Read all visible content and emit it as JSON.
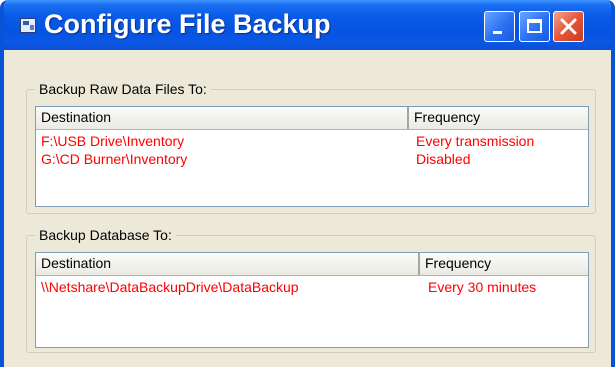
{
  "window": {
    "title": "Configure File Backup",
    "icon": "app-window-icon",
    "controls": [
      "minimize-icon",
      "maximize-icon",
      "close-icon"
    ]
  },
  "raw_files_group": {
    "label": "Backup Raw Data Files To:",
    "columns": [
      "Destination",
      "Frequency"
    ],
    "rows": [
      {
        "destination": "F:\\USB Drive\\Inventory",
        "frequency": "Every transmission"
      },
      {
        "destination": "G:\\CD Burner\\Inventory",
        "frequency": "Disabled"
      }
    ]
  },
  "database_group": {
    "label": "Backup Database To:",
    "columns": [
      "Destination",
      "Frequency"
    ],
    "rows": [
      {
        "destination": "\\\\Netshare\\DataBackupDrive\\DataBackup",
        "frequency": "Every 30 minutes"
      }
    ]
  },
  "colors": {
    "titlebar": "#0a5ce8",
    "window_bg": "#ece9d8",
    "row_text": "#ff0000",
    "close_button": "#e5563a"
  }
}
